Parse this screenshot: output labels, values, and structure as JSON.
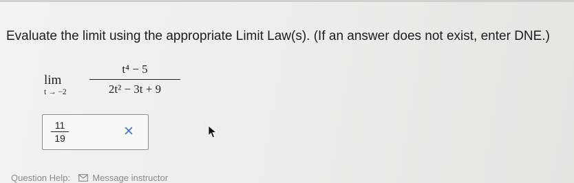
{
  "question": {
    "prompt": "Evaluate the limit using the appropriate Limit Law(s). (If an answer does not exist, enter DNE.)",
    "limit": {
      "operator": "lim",
      "subscript": "t → −2",
      "numerator": "t⁴ − 5",
      "denominator": "2t² − 3t + 9"
    }
  },
  "answer": {
    "numerator": "11",
    "denominator": "19",
    "status_icon": "x-icon",
    "status": "incorrect",
    "status_color": "#3f6fd1"
  },
  "footer": {
    "help_label": "Question Help:",
    "message_label": "Message instructor",
    "message_icon": "envelope-icon"
  }
}
